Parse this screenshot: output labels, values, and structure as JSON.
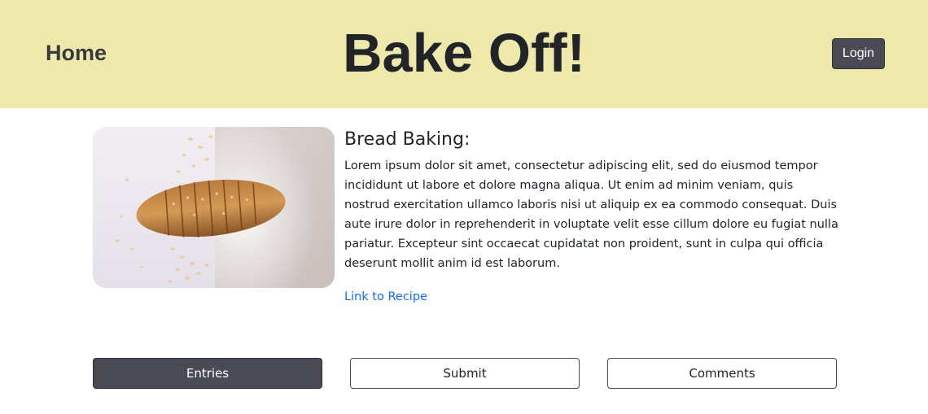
{
  "header": {
    "home_label": "Home",
    "site_title": "Bake Off!",
    "login_label": "Login",
    "background_color": "#eee8aa"
  },
  "recipe": {
    "image_icon": "sliced-bread-image",
    "title": "Bread Baking:",
    "body": "Lorem ipsum dolor sit amet, consectetur adipiscing elit, sed do eiusmod tempor incididunt ut labore et dolore magna aliqua. Ut enim ad minim veniam, quis nostrud exercitation ullamco laboris nisi ut aliquip ex ea commodo consequat. Duis aute irure dolor in reprehenderit in voluptate velit esse cillum dolore eu fugiat nulla pariatur. Excepteur sint occaecat cupidatat non proident, sunt in culpa qui officia deserunt mollit anim id est laborum.",
    "link_label": "Link to Recipe",
    "link_color": "#0d6efd"
  },
  "tabs": {
    "entries_label": "Entries",
    "submit_label": "Submit",
    "comments_label": "Comments",
    "active_tab": "Entries",
    "active_color": "#4a4a55"
  }
}
